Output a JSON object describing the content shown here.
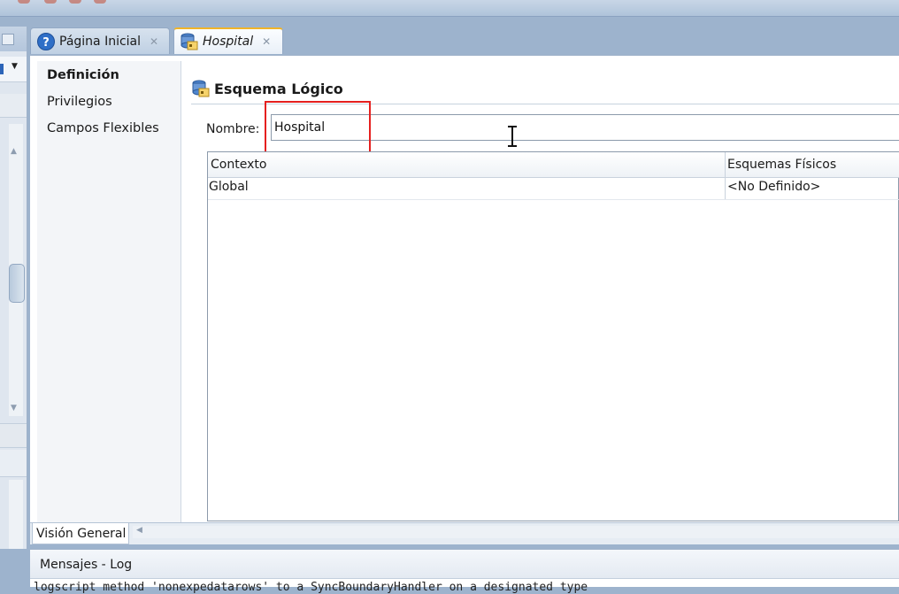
{
  "tabs": [
    {
      "label": "Página Inicial",
      "icon": "help-icon"
    },
    {
      "label": "Hospital",
      "icon": "logical-schema-icon",
      "active": true
    }
  ],
  "nav": {
    "items": [
      {
        "label": "Definición",
        "selected": true
      },
      {
        "label": "Privilegios"
      },
      {
        "label": "Campos Flexibles"
      }
    ]
  },
  "section": {
    "title": "Esquema Lógico",
    "icon": "logical-schema-icon"
  },
  "form": {
    "nombre_label": "Nombre:",
    "nombre_value": "Hospital"
  },
  "table": {
    "columns": [
      "Contexto",
      "Esquemas Físicos"
    ],
    "rows": [
      [
        "Global",
        "<No Definido>"
      ]
    ]
  },
  "bottom_tab": {
    "label": "Visión General"
  },
  "messages": {
    "title": "Mensajes - Log",
    "line": "logscript method 'nonexpedatarows' to a SyncBoundaryHandler on a designated type"
  },
  "colors": {
    "highlight": "#e5201f",
    "tab_accent": "#f0b429"
  }
}
